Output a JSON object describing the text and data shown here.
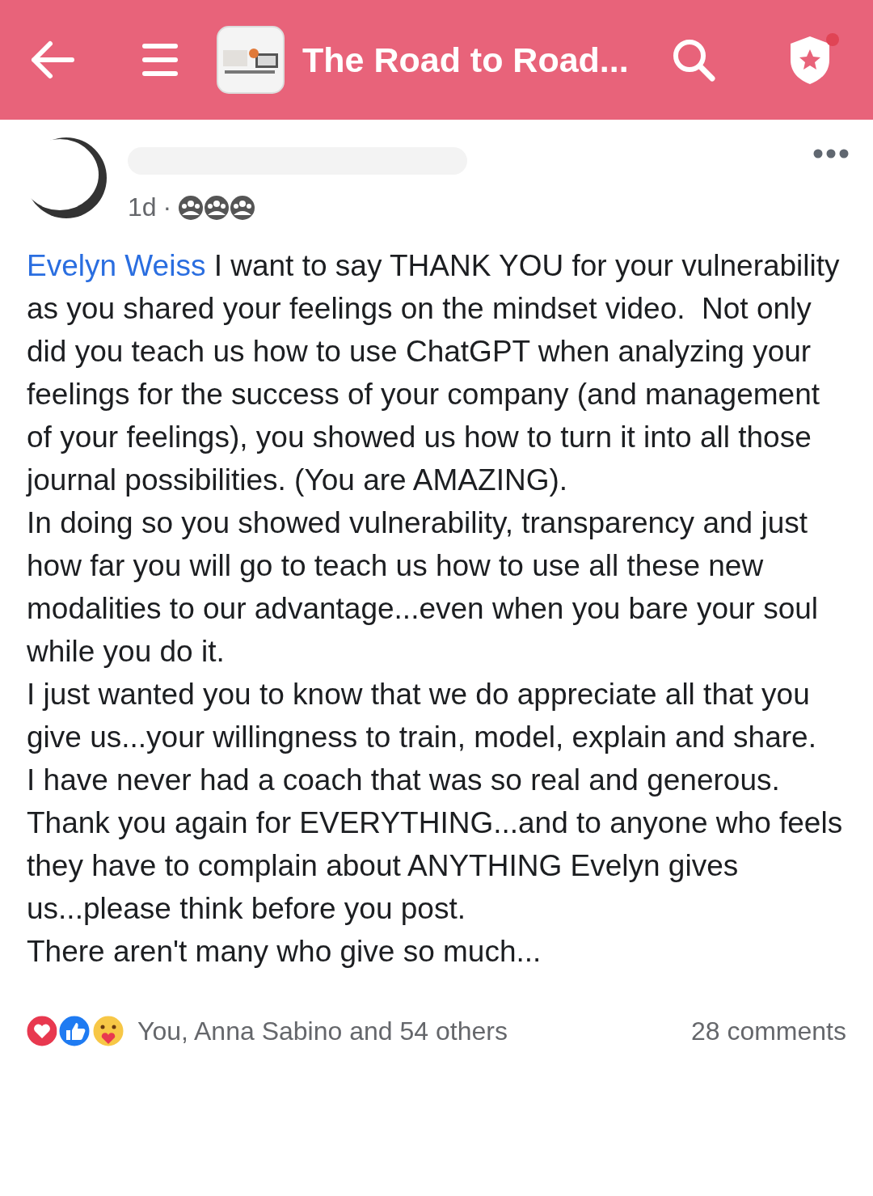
{
  "header": {
    "title": "The Road to Road..."
  },
  "post": {
    "time": "1d",
    "separator": "·",
    "mention": "Evelyn Weiss",
    "paragraphs": [
      "I want to say THANK YOU for your vulnerability as you shared your feelings on the mindset video.  Not only did you teach us how to use ChatGPT when analyzing your feelings for the success of your company (and management of your feelings), you showed us how to turn it into all those journal possibilities. (You are AMAZING).",
      "In doing so you showed vulnerability, transparency and just how far you will go to teach us how to use all these new modalities to our advantage...even when you bare your soul while you do it.",
      "I just wanted you to know that we do appreciate all that you give us...your willingness to train, model, explain and share.",
      "I have never had a coach that was so real and generous.",
      "Thank you again for EVERYTHING...and to anyone who feels they have to complain about ANYTHING Evelyn gives us...please think before you post.",
      "There aren't many who give so much..."
    ]
  },
  "footer": {
    "reactions": "You, Anna Sabino and 54 others",
    "comments": "28 comments"
  }
}
